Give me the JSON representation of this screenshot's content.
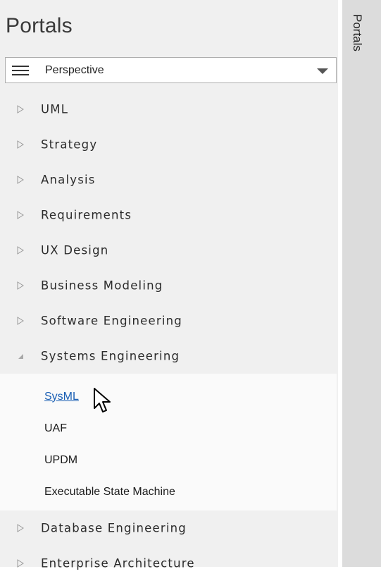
{
  "panel": {
    "title": "Portals",
    "side_tab_label": "Portals"
  },
  "perspective": {
    "selected": "Perspective",
    "icon": "hamburger-menu-icon"
  },
  "tree": {
    "items": [
      {
        "label": "UML",
        "expanded": false
      },
      {
        "label": "Strategy",
        "expanded": false
      },
      {
        "label": "Analysis",
        "expanded": false
      },
      {
        "label": "Requirements",
        "expanded": false
      },
      {
        "label": "UX Design",
        "expanded": false
      },
      {
        "label": "Business Modeling",
        "expanded": false
      },
      {
        "label": "Software Engineering",
        "expanded": false
      },
      {
        "label": "Systems Engineering",
        "expanded": true
      },
      {
        "label": "Database Engineering",
        "expanded": false
      },
      {
        "label": "Enterprise Architecture",
        "expanded": false
      }
    ],
    "systems_engineering_children": [
      {
        "label": "SysML",
        "hovered": true
      },
      {
        "label": "UAF"
      },
      {
        "label": "UPDM"
      },
      {
        "label": "Executable State Machine"
      }
    ]
  },
  "colors": {
    "panel_bg": "#f0f0f0",
    "link": "#1a5fb4",
    "side_tab_bg": "#dcdcdc"
  }
}
